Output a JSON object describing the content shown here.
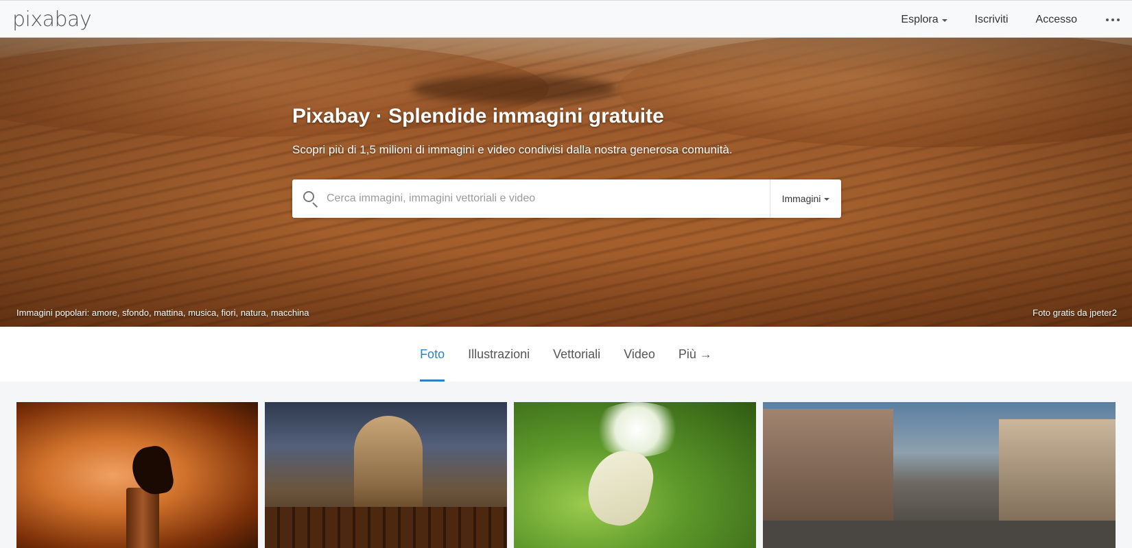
{
  "header": {
    "logo": "pixabay",
    "nav": {
      "explore": "Esplora",
      "signup": "Iscriviti",
      "login": "Accesso"
    }
  },
  "hero": {
    "title": "Pixabay · Splendide immagini gratuite",
    "subtitle": "Scopri più di 1,5 milioni di immagini e video condivisi dalla nostra generosa comunità.",
    "search": {
      "placeholder": "Cerca immagini, immagini vettoriali e video",
      "value": "",
      "type_label": "Immagini"
    },
    "popular": {
      "label": "Immagini popolari:",
      "tags": [
        "amore",
        "sfondo",
        "mattina",
        "musica",
        "fiori",
        "natura",
        "macchina"
      ]
    },
    "credit": "Foto gratis da jpeter2"
  },
  "tabs": [
    {
      "label": "Foto",
      "active": true
    },
    {
      "label": "Illustrazioni",
      "active": false
    },
    {
      "label": "Vettoriali",
      "active": false
    },
    {
      "label": "Video",
      "active": false
    },
    {
      "label": "Più →",
      "active": false
    }
  ],
  "colors": {
    "accent": "#2a80c9",
    "nav_bg": "#f8f9fa",
    "page_bg": "#f5f6f7"
  }
}
